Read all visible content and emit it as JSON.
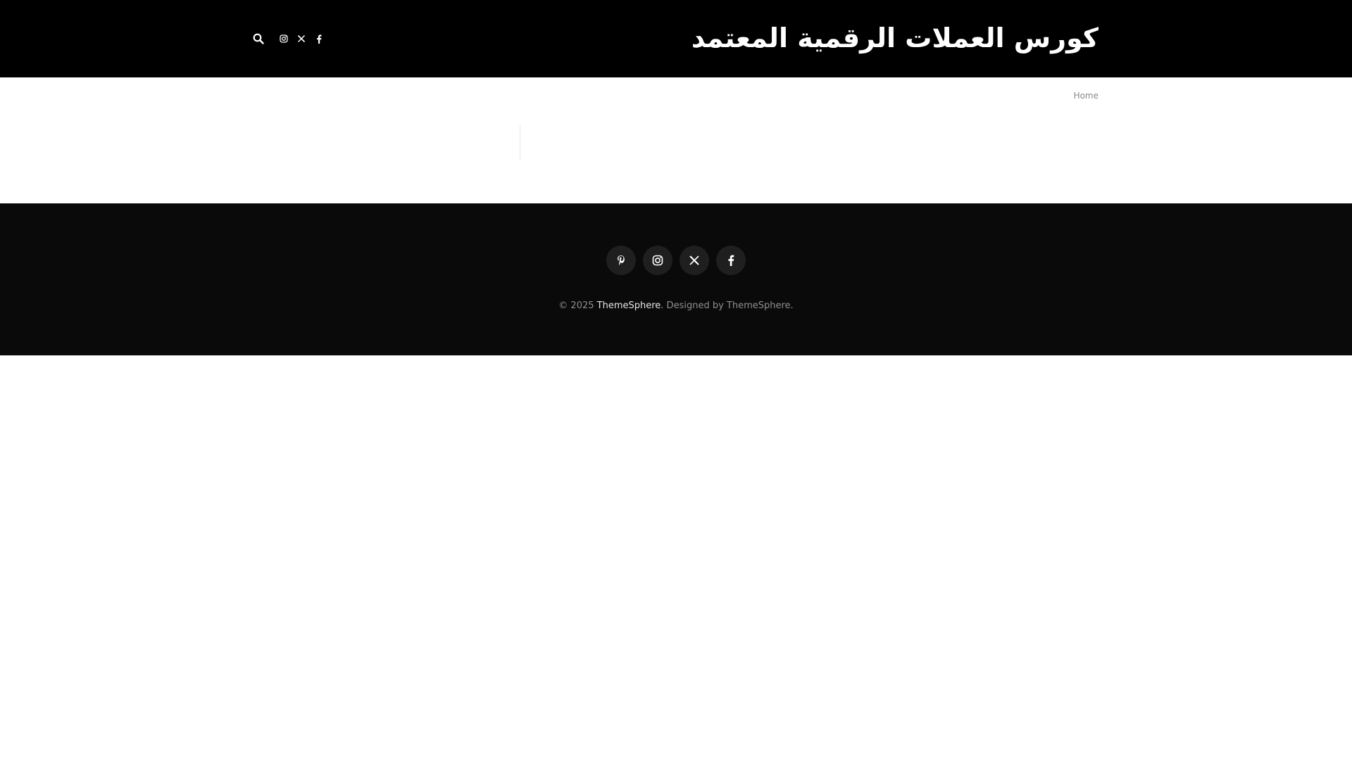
{
  "header": {
    "site_title": "كورس العملات الرقمية المعتمد",
    "icons": {
      "search": "search-icon",
      "instagram": "instagram-icon",
      "x": "x-icon",
      "facebook": "facebook-icon"
    }
  },
  "breadcrumb": {
    "home_label": "Home"
  },
  "footer": {
    "social": [
      "pinterest-icon",
      "instagram-icon",
      "x-icon",
      "facebook-icon"
    ],
    "copyright_prefix": "© 2025 ",
    "copyright_link": "ThemeSphere",
    "copyright_suffix": ". Designed by ThemeSphere."
  },
  "colors": {
    "header_bg": "#000000",
    "footer_bg": "#0a0a0a",
    "social_circle_bg": "#1f1f1f",
    "muted_text": "#888888"
  }
}
